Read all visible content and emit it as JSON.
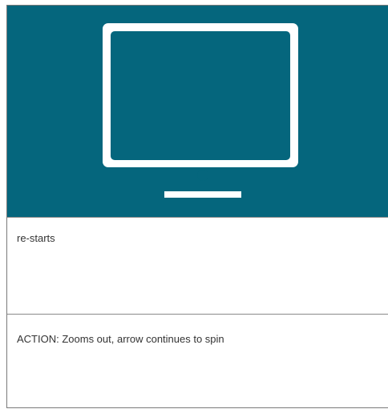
{
  "hero": {
    "background_color": "#05667d",
    "icon": "monitor-icon"
  },
  "rows": [
    {
      "text": "re-starts"
    },
    {
      "text": "ACTION: Zooms out, arrow continues to spin"
    }
  ]
}
